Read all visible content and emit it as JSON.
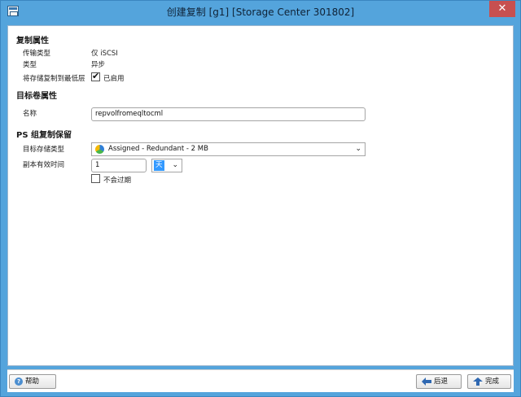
{
  "window": {
    "title": "创建复制 [g1] [Storage Center 301802]",
    "close_glyph": "✕"
  },
  "replication_props": {
    "heading": "复制属性",
    "transport_label": "传输类型",
    "transport_value": "仅 iSCSI",
    "type_label": "类型",
    "type_value": "异步",
    "lowest_tier_label": "将存储复制到最低层",
    "lowest_tier_checked": true,
    "lowest_tier_value": "已启用"
  },
  "target_volume": {
    "heading": "目标卷属性",
    "name_label": "名称",
    "name_value": "repvolfromeqltocml"
  },
  "ps_group": {
    "heading": "PS 组复制保留",
    "storage_type_label": "目标存储类型",
    "storage_type_value": "Assigned - Redundant - 2 MB",
    "expire_label": "副本有效时间",
    "expire_value": "1",
    "expire_unit": "天",
    "never_expire_label": "不会过期",
    "never_expire_checked": false
  },
  "footer": {
    "help_label": "帮助",
    "back_label": "后退",
    "finish_label": "完成"
  },
  "colors": {
    "titlebar": "#54a4dc",
    "close": "#c75050",
    "back_arrow": "#2e67b1",
    "finish_arrow": "#2e67b1"
  }
}
